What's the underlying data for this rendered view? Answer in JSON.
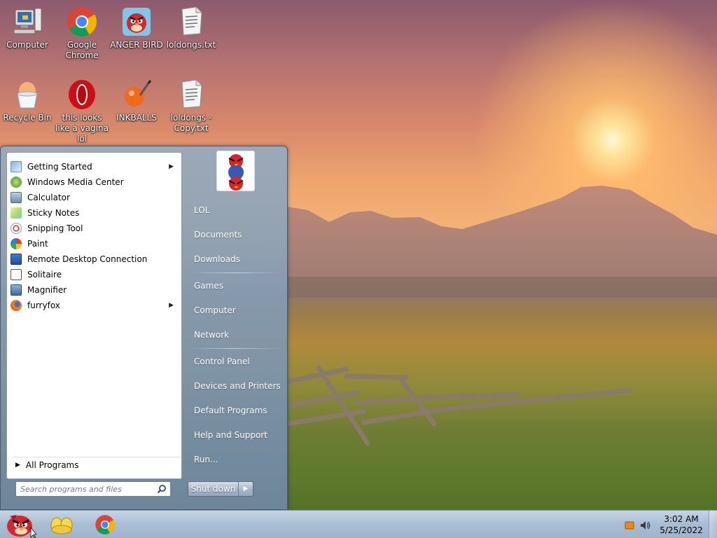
{
  "desktop": {
    "icons": [
      {
        "label": "Computer",
        "icon": "computer-icon"
      },
      {
        "label": "Google Chrome",
        "icon": "chrome-icon"
      },
      {
        "label": "ANGER BIRD",
        "icon": "angry-bird-icon"
      },
      {
        "label": "loldongs.txt",
        "icon": "text-file-icon"
      },
      {
        "label": "Recycle Bin",
        "icon": "recycle-bin-icon"
      },
      {
        "label": "this looks like a vagina lol",
        "icon": "opera-icon"
      },
      {
        "label": "INKBALLS",
        "icon": "inkballs-icon"
      },
      {
        "label": "loldongs - Copy.txt",
        "icon": "text-file-icon"
      }
    ]
  },
  "start_menu": {
    "programs": [
      {
        "label": "Getting Started",
        "has_submenu": true,
        "icon": "getting-started-icon"
      },
      {
        "label": "Windows Media Center",
        "has_submenu": false,
        "icon": "media-center-icon"
      },
      {
        "label": "Calculator",
        "has_submenu": false,
        "icon": "calculator-icon"
      },
      {
        "label": "Sticky Notes",
        "has_submenu": false,
        "icon": "sticky-notes-icon"
      },
      {
        "label": "Snipping Tool",
        "has_submenu": false,
        "icon": "snipping-tool-icon"
      },
      {
        "label": "Paint",
        "has_submenu": false,
        "icon": "paint-icon"
      },
      {
        "label": "Remote Desktop Connection",
        "has_submenu": false,
        "icon": "remote-desktop-icon"
      },
      {
        "label": "Solitaire",
        "has_submenu": false,
        "icon": "solitaire-icon"
      },
      {
        "label": "Magnifier",
        "has_submenu": false,
        "icon": "magnifier-icon"
      },
      {
        "label": "furryfox",
        "has_submenu": true,
        "icon": "firefox-icon"
      }
    ],
    "all_programs_label": "All Programs",
    "search_placeholder": "Search programs and files",
    "right_items": [
      {
        "label": "LOL"
      },
      {
        "label": "Documents"
      },
      {
        "label": "Downloads"
      },
      {
        "label": "Games"
      },
      {
        "label": "Computer"
      },
      {
        "label": "Network"
      },
      {
        "label": "Control Panel"
      },
      {
        "label": "Devices and Printers"
      },
      {
        "label": "Default Programs"
      },
      {
        "label": "Help and Support"
      },
      {
        "label": "Run..."
      }
    ],
    "shutdown_label": "Shut down"
  },
  "taskbar": {
    "pinned": [
      "folder-icon",
      "chrome-icon"
    ],
    "clock": {
      "time": "3:02 AM",
      "date": "5/25/2022"
    }
  },
  "colors": {
    "taskbar": "#a8bdd3",
    "menu_left_bg": "#ffffff",
    "menu_right_bg": "#8aa0b8"
  }
}
